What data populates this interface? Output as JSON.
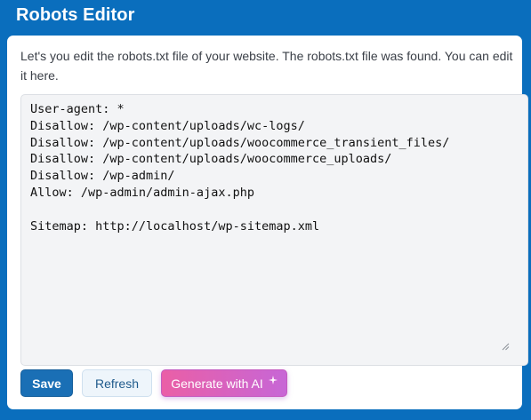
{
  "header": {
    "title": "Robots Editor"
  },
  "card": {
    "description": "Let's you edit the robots.txt file of your website. The robots.txt file was found. You can edit it here.",
    "robots_content": "User-agent: *\nDisallow: /wp-content/uploads/wc-logs/\nDisallow: /wp-content/uploads/woocommerce_transient_files/\nDisallow: /wp-content/uploads/woocommerce_uploads/\nDisallow: /wp-admin/\nAllow: /wp-admin/admin-ajax.php\n\nSitemap: http://localhost/wp-sitemap.xml"
  },
  "buttons": {
    "save_label": "Save",
    "refresh_label": "Refresh",
    "ai_label": "Generate with AI",
    "ai_icon": "sparkle-icon"
  },
  "colors": {
    "page_background": "#0a6ebd",
    "save_button": "#1a6fb5",
    "ai_gradient_start": "#ea5fa6",
    "ai_gradient_end": "#c766d6"
  }
}
